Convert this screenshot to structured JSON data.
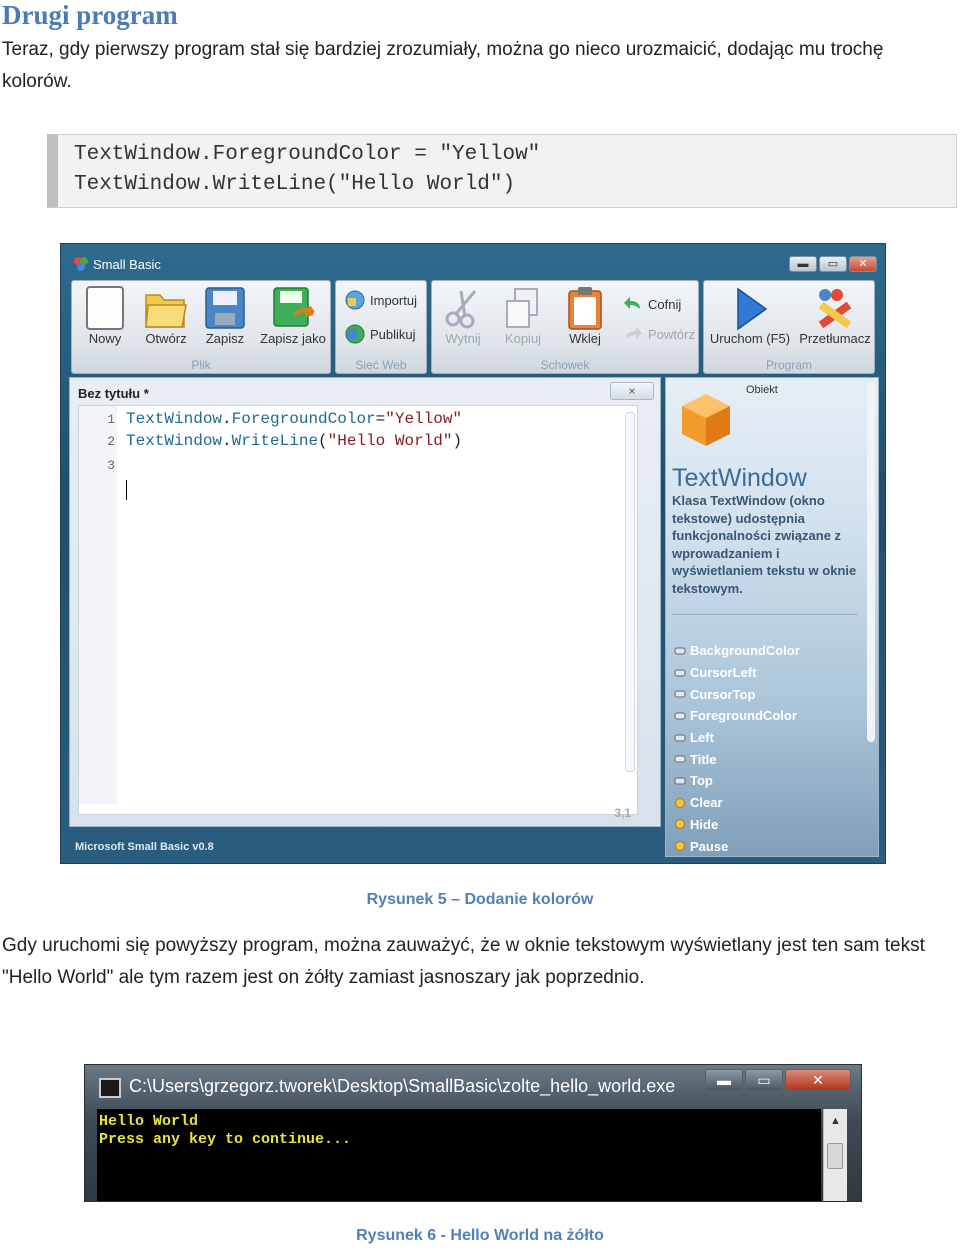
{
  "heading": "Drugi program",
  "intro": "Teraz, gdy pierwszy program stał się bardziej zrozumiały, można go nieco urozmaicić, dodając mu trochę kolorów.",
  "code_block": {
    "line1": "TextWindow.ForegroundColor = \"Yellow\"",
    "line2": "TextWindow.WriteLine(\"Hello World\")"
  },
  "small_basic": {
    "title": "Small Basic",
    "ribbon": {
      "new": "Nowy",
      "open": "Otwórz",
      "save": "Zapisz",
      "save_as": "Zapisz jako",
      "group_file": "Plik",
      "import": "Importuj",
      "publish": "Publikuj",
      "group_web": "Sieć Web",
      "cut": "Wytnij",
      "copy": "Kopiuj",
      "paste": "Wklej",
      "group_clipboard": "Schowek",
      "undo": "Cofnij",
      "redo": "Powtórz",
      "run": "Uruchom (F5)",
      "translator": "Przetłumacz",
      "group_program": "Program"
    },
    "doc_title": "Bez tytułu *",
    "doc_close": "×",
    "line_numbers": [
      "1",
      "2",
      "3"
    ],
    "code": {
      "l1_obj": "TextWindow",
      "l1_dot": ".",
      "l1_prop": "ForegroundColor",
      "l1_eq": "=",
      "l1_str": "\"Yellow\"",
      "l2_obj": "TextWindow",
      "l2_dot": ".",
      "l2_prop": "WriteLine",
      "l2_open": "(",
      "l2_str": "\"Hello World\"",
      "l2_close": ")"
    },
    "cursor_pos": "3,1",
    "help": {
      "label": "Obiekt",
      "title": "TextWindow",
      "description": "Klasa TextWindow (okno tekstowe) udostępnia funkcjonalności związane z wprowadzaniem i wyświetlaniem tekstu w oknie tekstowym.",
      "items": [
        "BackgroundColor",
        "CursorLeft",
        "CursorTop",
        "ForegroundColor",
        "Left",
        "Title",
        "Top",
        "Clear",
        "Hide",
        "Pause"
      ]
    },
    "status": "Microsoft Small Basic v0.8"
  },
  "caption1": "Rysunek 5 – Dodanie kolorów",
  "paragraph2": "Gdy uruchomi się powyższy program, można zauważyć, że w oknie tekstowym wyświetlany jest ten sam tekst \"Hello World\" ale tym razem jest on żółty zamiast jasnoszary jak poprzednio.",
  "console": {
    "title": "C:\\Users\\grzegorz.tworek\\Desktop\\SmallBasic\\zolte_hello_world.exe",
    "line1": "Hello World",
    "line2": "Press any key to continue...",
    "text_color": "#e8e43c"
  },
  "caption2": "Rysunek 6 - Hello World na żółto",
  "colors": {
    "heading": "#4a7ab8",
    "caption": "#4f81bd"
  }
}
